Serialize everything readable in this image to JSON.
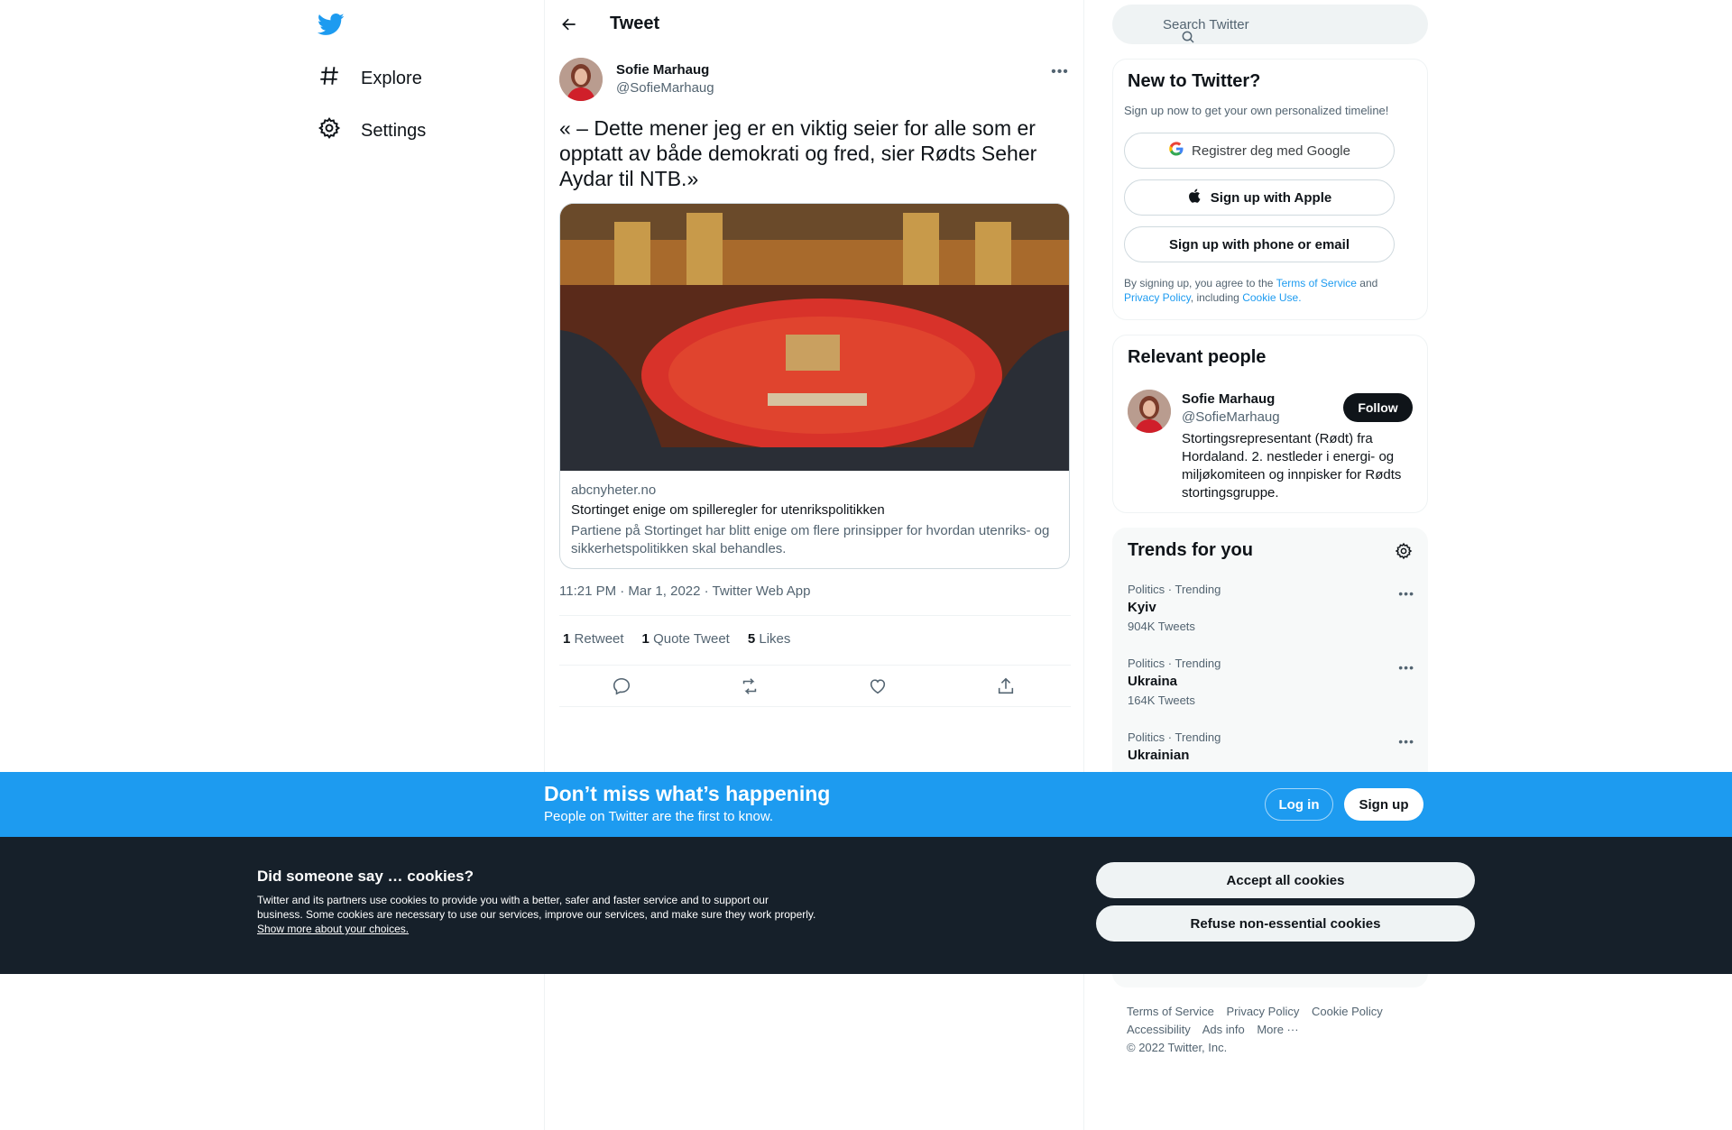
{
  "nav": {
    "items": [
      {
        "label": "Explore"
      },
      {
        "label": "Settings"
      }
    ]
  },
  "header": {
    "title": "Tweet"
  },
  "tweet": {
    "author_name": "Sofie Marhaug",
    "author_handle": "@SofieMarhaug",
    "text": "« – Dette mener jeg er en viktig seier for alle som er opptatt av både demokrati og fred, sier Rødts Seher Aydar til NTB.»",
    "card": {
      "domain": "abcnyheter.no",
      "title": "Stortinget enige om spilleregler for utenrikspolitikken",
      "description": "Partiene på Stortinget har blitt enige om flere prinsipper for hvordan utenriks- og sikkerhetspolitikken skal behandles."
    },
    "meta": "11:21 PM · Mar 1, 2022 · Twitter Web App",
    "stats": {
      "retweets_count": "1",
      "retweets_label": "Retweet",
      "quotes_count": "1",
      "quotes_label": "Quote Tweet",
      "likes_count": "5",
      "likes_label": "Likes"
    }
  },
  "search": {
    "placeholder": "Search Twitter"
  },
  "signup_box": {
    "title": "New to Twitter?",
    "subtitle": "Sign up now to get your own personalized timeline!",
    "google_label": "Registrer deg med Google",
    "apple_label": "Sign up with Apple",
    "phone_label": "Sign up with phone or email",
    "legal_prefix": "By signing up, you agree to the",
    "terms_link": "Terms of Service",
    "legal_and": "and",
    "privacy_link": "Privacy Policy",
    "legal_including": ", including",
    "cookie_link": "Cookie Use."
  },
  "relevant_people": {
    "title": "Relevant people",
    "name": "Sofie Marhaug",
    "handle": "@SofieMarhaug",
    "follow_label": "Follow",
    "bio": "Stortingsrepresentant (Rødt) fra Hordaland. 2. nestleder i energi- og miljøkomiteen og innpisker for Rødts stortingsgruppe."
  },
  "trends": {
    "title": "Trends for you",
    "items": [
      {
        "category": "Politics · Trending",
        "name": "Kyiv",
        "count": "904K Tweets"
      },
      {
        "category": "Politics · Trending",
        "name": "Ukraina",
        "count": "164K Tweets"
      },
      {
        "category": "Politics · Trending",
        "name": "Ukrainian",
        "count": ""
      }
    ]
  },
  "footer": {
    "links": [
      "Terms of Service",
      "Privacy Policy",
      "Cookie Policy",
      "Accessibility",
      "Ads info",
      "More ···"
    ],
    "copyright": "© 2022 Twitter, Inc."
  },
  "banner": {
    "title": "Don’t miss what’s happening",
    "subtitle": "People on Twitter are the first to know.",
    "login_label": "Log in",
    "signup_label": "Sign up"
  },
  "cookies": {
    "title": "Did someone say … cookies?",
    "text": "Twitter and its partners use cookies to provide you with a better, safer and faster service and to support our business. Some cookies are necessary to use our services, improve our services, and make sure they work properly.",
    "link": "Show more about your choices.",
    "accept_label": "Accept all cookies",
    "refuse_label": "Refuse non-essential cookies"
  },
  "colors": {
    "accent": "#1d9bf0",
    "text_primary": "#0f1419",
    "text_secondary": "#536471",
    "cookie_bg": "#16202a"
  },
  "icons": [
    "twitter-logo-icon",
    "hashtag-icon",
    "gear-icon",
    "back-arrow-icon",
    "more-icon",
    "search-icon",
    "google-icon",
    "apple-icon",
    "reply-icon",
    "retweet-icon",
    "like-icon",
    "share-icon"
  ]
}
